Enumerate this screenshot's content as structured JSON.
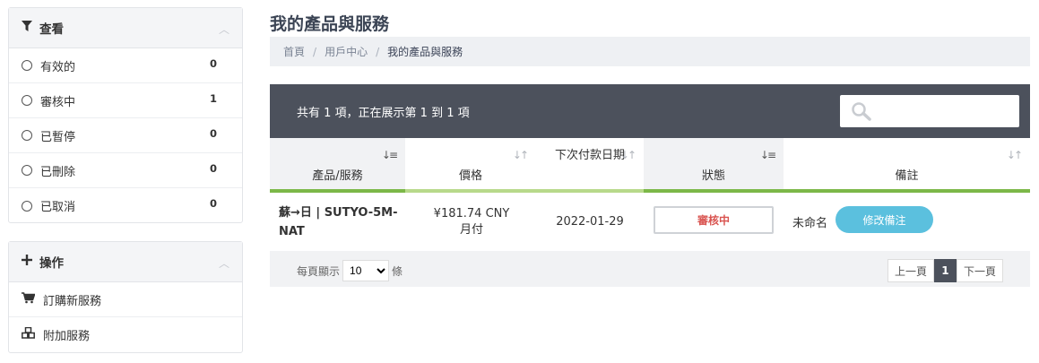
{
  "sidebar": {
    "view_panel": {
      "title": "查看",
      "items": [
        {
          "label": "有效的",
          "count": "0"
        },
        {
          "label": "審核中",
          "count": "1"
        },
        {
          "label": "已暫停",
          "count": "0"
        },
        {
          "label": "已刪除",
          "count": "0"
        },
        {
          "label": "已取消",
          "count": "0"
        }
      ]
    },
    "actions_panel": {
      "title": "操作",
      "items": [
        {
          "label": "訂購新服務",
          "icon": "cart-icon"
        },
        {
          "label": "附加服務",
          "icon": "cubes-icon"
        }
      ]
    }
  },
  "main": {
    "title": "我的產品與服務",
    "breadcrumb": [
      "首頁",
      "用戶中心",
      "我的產品與服務"
    ],
    "table_info": "共有 1 項，正在展示第 1 到 1 項",
    "search_placeholder": "",
    "columns": [
      "產品/服務",
      "價格",
      "下次付款日期",
      "狀態",
      "備註"
    ],
    "rows": [
      {
        "product": "蘇→日 | SUTYO-5M-NAT",
        "price": "¥181.74 CNY",
        "cycle": "月付",
        "next_due": "2022-01-29",
        "status": "審核中",
        "note": "未命名",
        "edit_label": "修改備注"
      }
    ],
    "footer": {
      "per_page_label": "每頁顯示",
      "per_page_value": "10",
      "per_page_suffix": "條",
      "prev": "上一頁",
      "current_page": "1",
      "next": "下一頁"
    }
  },
  "colors": {
    "table_header_bg": "#4c515c",
    "accent_green": "#7cb848",
    "status_red": "#d9534f",
    "button_blue": "#5bc0de"
  }
}
